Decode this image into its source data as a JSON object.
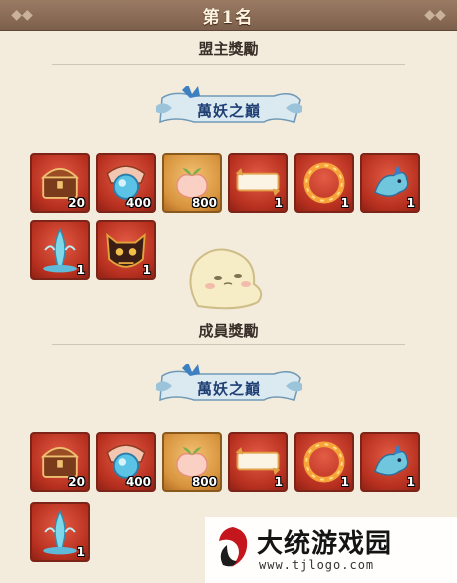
{
  "header": {
    "title": "第1名"
  },
  "sections": [
    {
      "title": "盟主獎勵",
      "scroll_label": "萬妖之巔",
      "items": [
        {
          "icon": "treasure-chest-icon",
          "qty": "20",
          "frame": "red"
        },
        {
          "icon": "blue-orb-gift-icon",
          "qty": "400",
          "frame": "red"
        },
        {
          "icon": "peach-icon",
          "qty": "800",
          "frame": "gold"
        },
        {
          "icon": "name-plate-icon",
          "qty": "1",
          "frame": "red"
        },
        {
          "icon": "fire-ring-frame-icon",
          "qty": "1",
          "frame": "red"
        },
        {
          "icon": "blue-dragon-icon",
          "qty": "1",
          "frame": "red"
        },
        {
          "icon": "water-fountain-icon",
          "qty": "1",
          "frame": "red"
        },
        {
          "icon": "demon-mask-icon",
          "qty": "1",
          "frame": "red"
        }
      ]
    },
    {
      "title": "成員獎勵",
      "scroll_label": "萬妖之巔",
      "items": [
        {
          "icon": "treasure-chest-icon",
          "qty": "20",
          "frame": "red"
        },
        {
          "icon": "blue-orb-gift-icon",
          "qty": "400",
          "frame": "red"
        },
        {
          "icon": "peach-icon",
          "qty": "800",
          "frame": "gold"
        },
        {
          "icon": "name-plate-icon",
          "qty": "1",
          "frame": "red"
        },
        {
          "icon": "fire-ring-frame-icon",
          "qty": "1",
          "frame": "red"
        },
        {
          "icon": "blue-dragon-icon",
          "qty": "1",
          "frame": "red"
        },
        {
          "icon": "water-fountain-icon",
          "qty": "1",
          "frame": "red"
        }
      ]
    }
  ],
  "watermark": {
    "name": "大统游戏园",
    "url": "www.tjlogo.com"
  },
  "colors": {
    "banner": "#8a6b56",
    "item_red": "#c23a27",
    "item_gold": "#e0a24e",
    "scroll_text": "#1f3f74",
    "background": "#f3ecdd"
  }
}
